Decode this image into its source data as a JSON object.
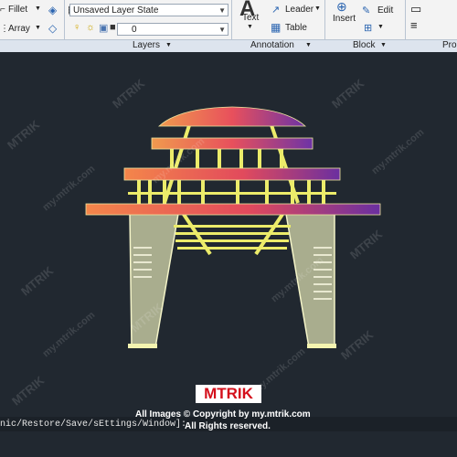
{
  "ribbon": {
    "modify": {
      "fillet": "Fillet",
      "array": "Array"
    },
    "layers": {
      "state": "Unsaved Layer State",
      "current_layer": "0",
      "title": "Layers"
    },
    "annotation": {
      "text": "Text",
      "leader": "Leader",
      "table": "Table",
      "title": "Annotation"
    },
    "block": {
      "insert": "Insert",
      "edit": "Edit",
      "title": "Block"
    },
    "properties": {
      "title": "Prop"
    }
  },
  "command_line": {
    "text": "nic/Restore/Save/sEttings/Window]:"
  },
  "watermark": {
    "logo_text": "MTRIK",
    "copyright_line1": "All Images © Copyright by my.mtrik.com",
    "copyright_line2": "All Rights reserved.",
    "tile_text": "my.mtrik.com",
    "tile_brand": "MTRIK"
  },
  "colors": {
    "canvas": "#212830",
    "pillar": "#a9ad8e",
    "gradient_start": "#f08a4a",
    "gradient_end": "#6a2fa0",
    "rails": "#ecec6a",
    "logo_red": "#d40f1b"
  }
}
